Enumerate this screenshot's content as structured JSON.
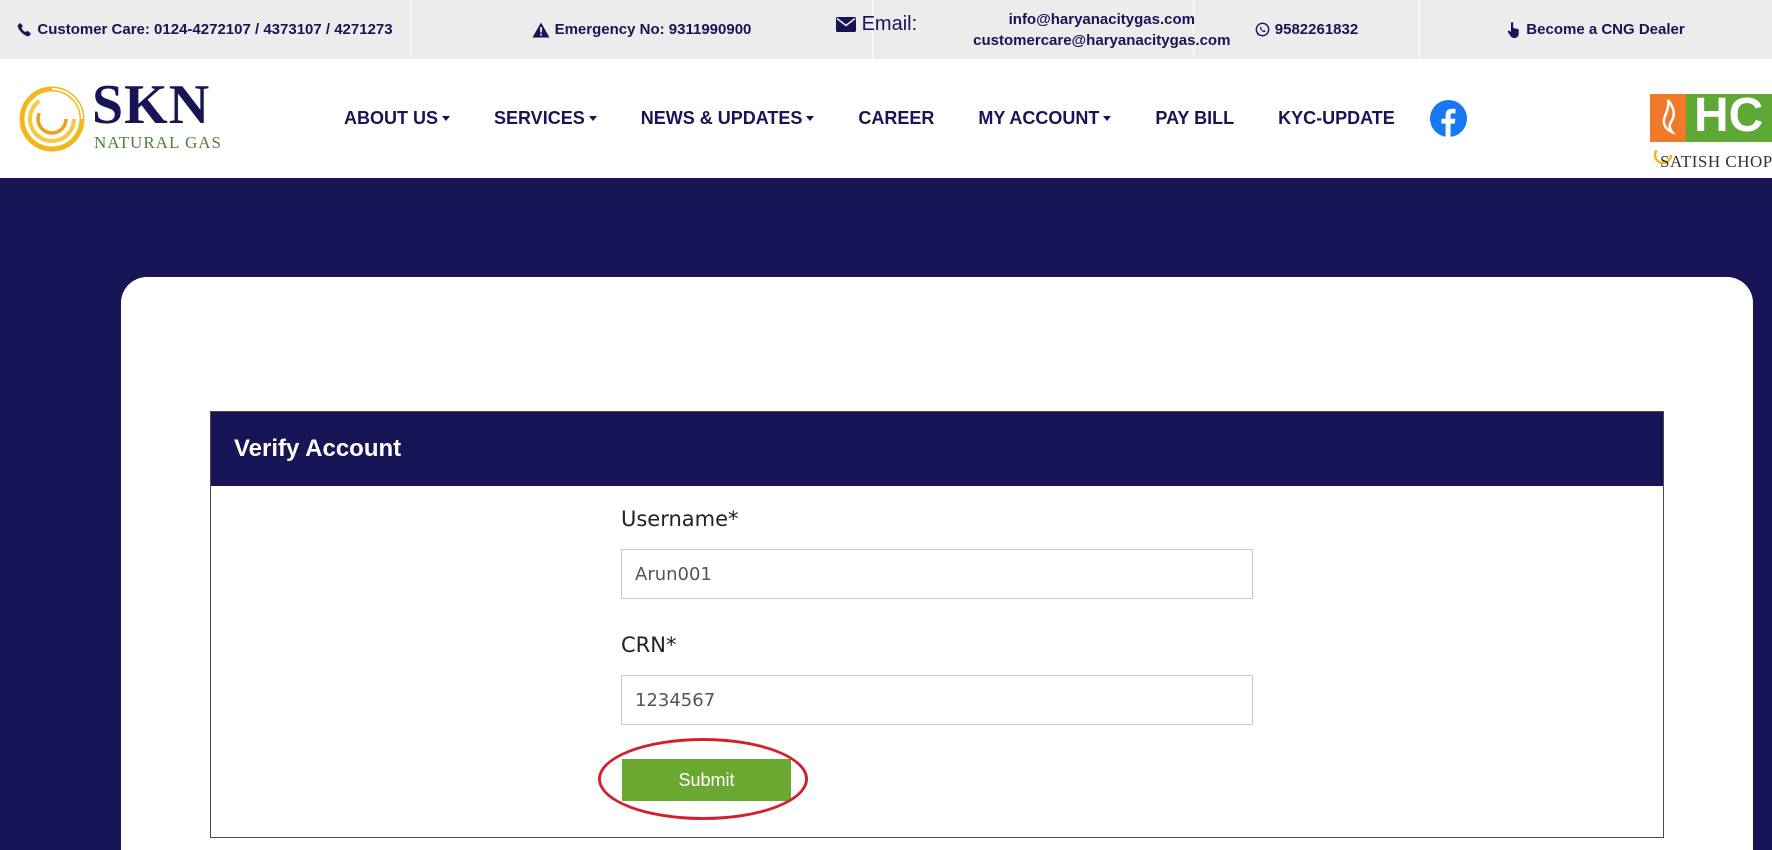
{
  "topbar": {
    "customer_care": "Customer Care: 0124-4272107 / 4373107 / 4271273",
    "emergency": "Emergency No: 9311990900",
    "email_label": "Email:",
    "emails": [
      "info@haryanacitygas.com",
      "customercare@haryanacitygas.com"
    ],
    "whatsapp": "9582261832",
    "dealer": "Become a CNG Dealer"
  },
  "logo": {
    "name": "SKN",
    "sub": "NATURAL GAS"
  },
  "nav": {
    "items": [
      {
        "label": "ABOUT US",
        "dropdown": true
      },
      {
        "label": "SERVICES",
        "dropdown": true
      },
      {
        "label": "NEWS & UPDATES",
        "dropdown": true
      },
      {
        "label": "CAREER",
        "dropdown": false
      },
      {
        "label": "MY ACCOUNT",
        "dropdown": true
      },
      {
        "label": "PAY BILL",
        "dropdown": false
      },
      {
        "label": "KYC-UPDATE",
        "dropdown": false
      }
    ],
    "social": "facebook-icon"
  },
  "partner": {
    "letters": "HC",
    "sub": "SATISH CHOP"
  },
  "form": {
    "title": "Verify Account",
    "username_label": "Username*",
    "username_value": "Arun001",
    "crn_label": "CRN*",
    "crn_value": "1234567",
    "submit_label": "Submit"
  },
  "colors": {
    "navy": "#171556",
    "green": "#6aa832",
    "highlight": "#d4202c",
    "facebook": "#1877f2"
  }
}
